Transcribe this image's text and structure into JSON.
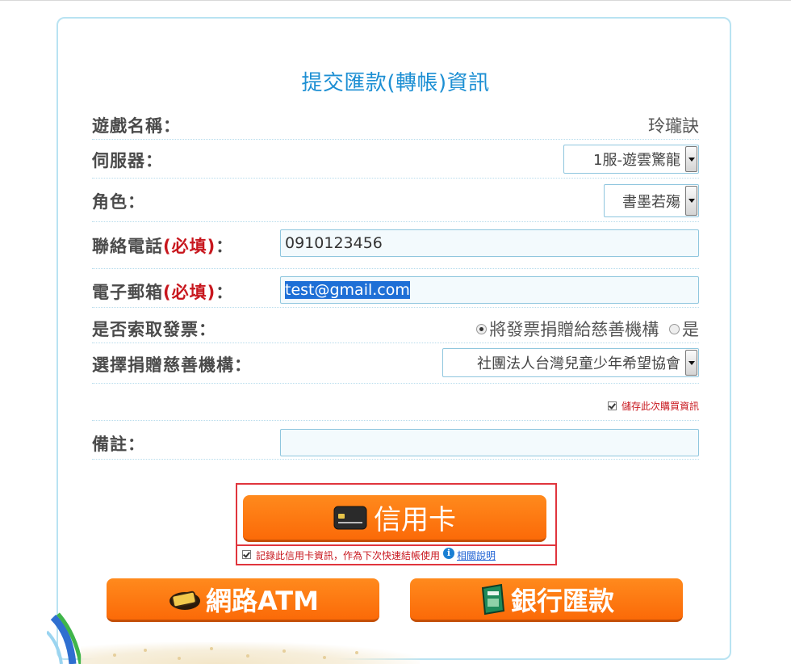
{
  "title": "提交匯款(轉帳)資訊",
  "form": {
    "game_label": "遊戲名稱：",
    "game_value": "玲瓏訣",
    "server_label": "伺服器：",
    "server_value": "1服-遊雲驚龍",
    "role_label": "角色：",
    "role_value": "書墨若殤",
    "phone_label": "聯絡電話",
    "phone_required": "(必填)",
    "phone_colon": "：",
    "phone_value": "0910123456",
    "email_label": "電子郵箱",
    "email_required": "(必填)",
    "email_colon": "：",
    "email_value": "test@gmail.com",
    "invoice_label": "是否索取發票：",
    "invoice_option_donate": "將發票捐贈給慈善機構",
    "invoice_option_yes": "是",
    "invoice_selected": "donate",
    "charity_label": "選擇捐贈慈善機構：",
    "charity_value": "社團法人台灣兒童少年希望協會",
    "save_purchase": "儲存此次購買資訊",
    "save_purchase_checked": true,
    "note_label": "備註：",
    "note_value": ""
  },
  "payment": {
    "credit_card_label": "信用卡",
    "credit_card_remember": "記錄此信用卡資訊，作為下次快速結帳使用",
    "credit_card_remember_checked": true,
    "related_info_link": "相關說明",
    "info_icon_glyph": "i",
    "atm_label": "網路ATM",
    "bank_label": "銀行匯款"
  },
  "colors": {
    "title": "#1d8fd3",
    "required": "#c8171e",
    "button": "#fb6a08",
    "highlight_border": "#e0353d",
    "panel_border": "#b9e3f2"
  },
  "icons": {
    "credit_card": "credit-card-icon",
    "atm": "atm-card-icon",
    "bank": "bank-transfer-icon",
    "info": "info-icon"
  }
}
